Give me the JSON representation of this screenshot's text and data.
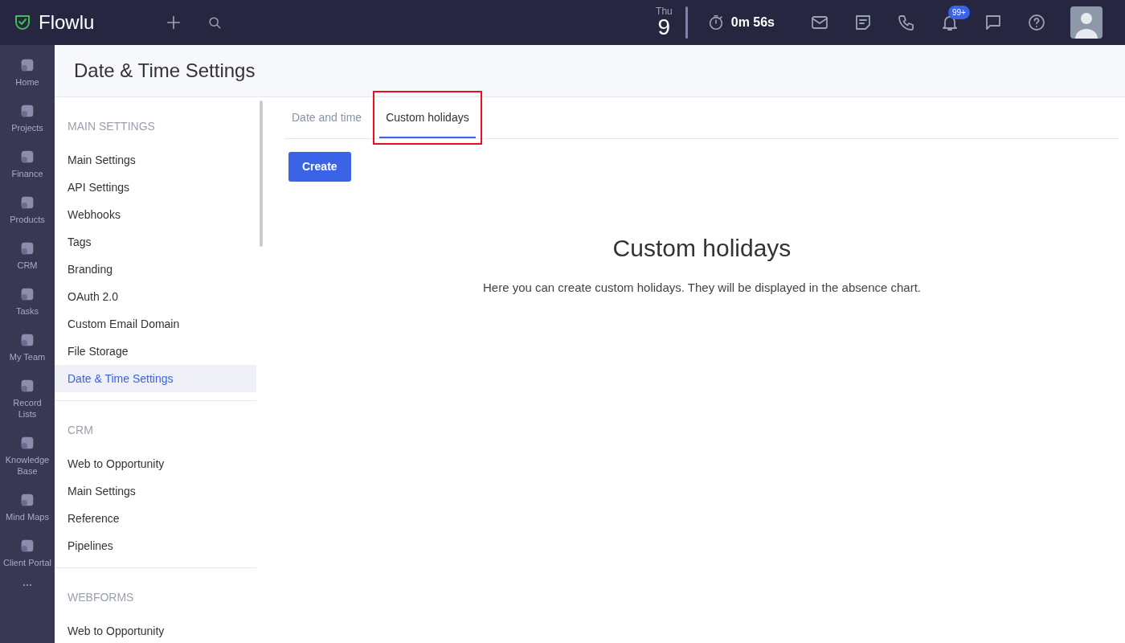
{
  "topbar": {
    "logo": "Flowlu",
    "day": "Thu",
    "date": "9",
    "timer": "0m 56s",
    "notifications_badge": "99+"
  },
  "rail": [
    {
      "label": "Home"
    },
    {
      "label": "Projects"
    },
    {
      "label": "Finance"
    },
    {
      "label": "Products"
    },
    {
      "label": "CRM"
    },
    {
      "label": "Tasks"
    },
    {
      "label": "My Team"
    },
    {
      "label": "Record Lists"
    },
    {
      "label": "Knowledge Base"
    },
    {
      "label": "Mind Maps"
    },
    {
      "label": "Client Portal"
    }
  ],
  "page_title": "Date & Time Settings",
  "settings_sections": [
    {
      "heading": "MAIN SETTINGS",
      "items": [
        {
          "label": "Main Settings",
          "selected": false
        },
        {
          "label": "API Settings",
          "selected": false
        },
        {
          "label": "Webhooks",
          "selected": false
        },
        {
          "label": "Tags",
          "selected": false
        },
        {
          "label": "Branding",
          "selected": false
        },
        {
          "label": "OAuth 2.0",
          "selected": false
        },
        {
          "label": "Custom Email Domain",
          "selected": false
        },
        {
          "label": "File Storage",
          "selected": false
        },
        {
          "label": "Date & Time Settings",
          "selected": true
        }
      ]
    },
    {
      "heading": "CRM",
      "items": [
        {
          "label": "Web to Opportunity",
          "selected": false
        },
        {
          "label": "Main Settings",
          "selected": false
        },
        {
          "label": "Reference",
          "selected": false
        },
        {
          "label": "Pipelines",
          "selected": false
        }
      ]
    },
    {
      "heading": "WEBFORMS",
      "items": [
        {
          "label": "Web to Opportunity",
          "selected": false
        }
      ]
    }
  ],
  "tabs": [
    {
      "label": "Date and time",
      "selected": false,
      "highlighted": false
    },
    {
      "label": "Custom holidays",
      "selected": true,
      "highlighted": true
    }
  ],
  "create_button": "Create",
  "empty_state": {
    "title": "Custom holidays",
    "text": "Here you can create custom holidays. They will be displayed in the absence chart."
  }
}
